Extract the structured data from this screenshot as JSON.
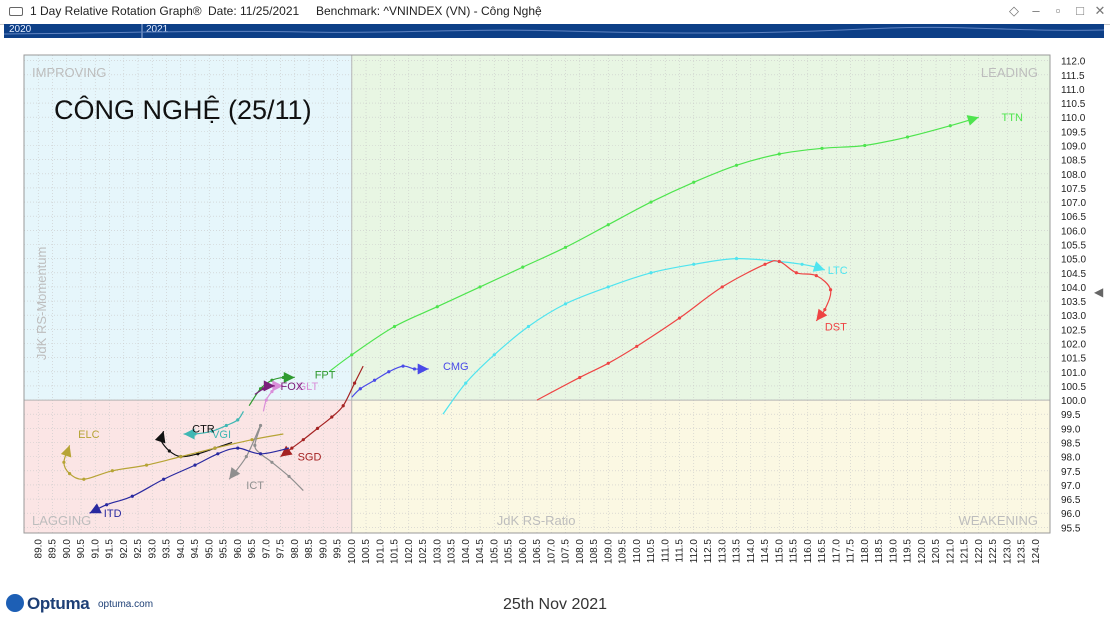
{
  "window": {
    "title": "1 Day Relative Rotation Graph®",
    "date_label": "Date: 11/25/2021",
    "benchmark_label": "Benchmark: ^VNINDEX (VN) - Công Nghệ"
  },
  "timeline": {
    "labels": [
      "2020",
      "2021"
    ]
  },
  "footer": {
    "brand": "Optuma",
    "brand_url": "optuma.com",
    "date_text": "25th Nov 2021"
  },
  "colors": {
    "improving": "#e6f6fb",
    "leading": "#e8f6e3",
    "weakening": "#fbf8e3",
    "lagging": "#fbe5e5",
    "grid": "#c9c9c9",
    "quadrant_label": "#bdbdbd",
    "header_blue": "#0d3f87"
  },
  "chart_data": {
    "type": "scatter",
    "title": "CÔNG NGHỆ (25/11)",
    "xlabel": "JdK RS-Ratio",
    "ylabel": "JdK RS-Momentum",
    "xlim": [
      88.5,
      124.5
    ],
    "ylim": [
      95.3,
      112.2
    ],
    "center": [
      100,
      100
    ],
    "grid": true,
    "quadrants": {
      "improving": "IMPROVING",
      "leading": "LEADING",
      "weakening": "WEAKENING",
      "lagging": "LAGGING"
    },
    "x_ticks": [
      "89.0",
      "89.5",
      "90.0",
      "90.5",
      "91.0",
      "91.5",
      "92.0",
      "92.5",
      "93.0",
      "93.5",
      "94.0",
      "94.5",
      "95.0",
      "95.5",
      "96.0",
      "96.5",
      "97.0",
      "97.5",
      "98.0",
      "98.5",
      "99.0",
      "99.5",
      "100.0",
      "100.5",
      "101.0",
      "101.5",
      "102.0",
      "102.5",
      "103.0",
      "103.5",
      "104.0",
      "104.5",
      "105.0",
      "105.5",
      "106.0",
      "106.5",
      "107.0",
      "107.5",
      "108.0",
      "108.5",
      "109.0",
      "109.5",
      "110.0",
      "110.5",
      "111.0",
      "111.5",
      "112.0",
      "112.5",
      "113.0",
      "113.5",
      "114.0",
      "114.5",
      "115.0",
      "115.5",
      "116.0",
      "116.5",
      "117.0",
      "117.5",
      "118.0",
      "118.5",
      "119.0",
      "119.5",
      "120.0",
      "120.5",
      "121.0",
      "121.5",
      "122.0",
      "122.5",
      "123.0",
      "123.5",
      "124.0"
    ],
    "y_ticks": [
      "95.5",
      "96.0",
      "96.5",
      "97.0",
      "97.5",
      "98.0",
      "98.5",
      "99.0",
      "99.5",
      "100.0",
      "100.5",
      "101.0",
      "101.5",
      "102.0",
      "102.5",
      "103.0",
      "103.5",
      "104.0",
      "104.5",
      "105.0",
      "105.5",
      "106.0",
      "106.5",
      "107.0",
      "107.5",
      "108.0",
      "108.5",
      "109.0",
      "109.5",
      "110.0",
      "110.5",
      "111.0",
      "111.5",
      "112.0"
    ],
    "series": [
      {
        "name": "TTN",
        "color": "#4ee44e",
        "label_at": [
          122.8,
          110.0
        ],
        "points": [
          [
            99.2,
            101.0
          ],
          [
            100.0,
            101.6
          ],
          [
            101.5,
            102.6
          ],
          [
            103.0,
            103.3
          ],
          [
            104.5,
            104.0
          ],
          [
            106.0,
            104.7
          ],
          [
            107.5,
            105.4
          ],
          [
            109.0,
            106.2
          ],
          [
            110.5,
            107.0
          ],
          [
            112.0,
            107.7
          ],
          [
            113.5,
            108.3
          ],
          [
            115.0,
            108.7
          ],
          [
            116.5,
            108.9
          ],
          [
            118.0,
            109.0
          ],
          [
            119.5,
            109.3
          ],
          [
            121.0,
            109.7
          ],
          [
            122.0,
            110.0
          ]
        ]
      },
      {
        "name": "LTC",
        "color": "#4fe4ef",
        "label_at": [
          116.7,
          104.6
        ],
        "points": [
          [
            103.2,
            99.5
          ],
          [
            104.0,
            100.6
          ],
          [
            105.0,
            101.6
          ],
          [
            106.2,
            102.6
          ],
          [
            107.5,
            103.4
          ],
          [
            109.0,
            104.0
          ],
          [
            110.5,
            104.5
          ],
          [
            112.0,
            104.8
          ],
          [
            113.5,
            105.0
          ],
          [
            115.0,
            104.9
          ],
          [
            115.8,
            104.8
          ],
          [
            116.3,
            104.7
          ],
          [
            116.6,
            104.6
          ]
        ]
      },
      {
        "name": "DST",
        "color": "#ee4444",
        "label_at": [
          116.6,
          102.6
        ],
        "points": [
          [
            106.5,
            100.0
          ],
          [
            108.0,
            100.8
          ],
          [
            109.0,
            101.3
          ],
          [
            110.0,
            101.9
          ],
          [
            111.5,
            102.9
          ],
          [
            113.0,
            104.0
          ],
          [
            114.5,
            104.8
          ],
          [
            115.0,
            104.9
          ],
          [
            115.6,
            104.5
          ],
          [
            116.3,
            104.4
          ],
          [
            116.8,
            103.9
          ],
          [
            116.6,
            103.2
          ],
          [
            116.3,
            102.8
          ]
        ]
      },
      {
        "name": "CMG",
        "color": "#4a4ae8",
        "label_at": [
          103.2,
          101.2
        ],
        "points": [
          [
            100.0,
            100.1
          ],
          [
            100.3,
            100.4
          ],
          [
            100.8,
            100.7
          ],
          [
            101.3,
            101.0
          ],
          [
            101.8,
            101.2
          ],
          [
            102.2,
            101.1
          ],
          [
            102.7,
            101.1
          ]
        ]
      },
      {
        "name": "FPT",
        "color": "#2f9a2f",
        "label_at": [
          98.7,
          100.9
        ],
        "points": [
          [
            96.4,
            99.8
          ],
          [
            96.8,
            100.4
          ],
          [
            97.2,
            100.7
          ],
          [
            97.6,
            100.8
          ],
          [
            98.0,
            100.8
          ]
        ]
      },
      {
        "name": "GLT",
        "color": "#d98ed9",
        "label_at": [
          98.1,
          100.5
        ],
        "points": [
          [
            96.9,
            99.6
          ],
          [
            97.0,
            100.0
          ],
          [
            97.2,
            100.3
          ],
          [
            97.4,
            100.5
          ],
          [
            97.6,
            100.5
          ]
        ]
      },
      {
        "name": "FOX",
        "color": "#7b1e7b",
        "label_at": [
          97.5,
          100.5
        ],
        "points": [
          [
            96.6,
            100.2
          ],
          [
            96.9,
            100.4
          ],
          [
            97.1,
            100.5
          ],
          [
            97.3,
            100.5
          ]
        ]
      },
      {
        "name": "VGI",
        "color": "#3fb7b3",
        "label_at": [
          95.1,
          98.8
        ],
        "points": [
          [
            96.2,
            99.6
          ],
          [
            96.0,
            99.3
          ],
          [
            95.6,
            99.1
          ],
          [
            95.1,
            98.9
          ],
          [
            94.5,
            98.8
          ],
          [
            94.1,
            98.8
          ]
        ]
      },
      {
        "name": "CTR",
        "color": "#111111",
        "label_at": [
          94.4,
          99.0
        ],
        "points": [
          [
            95.8,
            98.5
          ],
          [
            95.2,
            98.3
          ],
          [
            94.6,
            98.1
          ],
          [
            94.0,
            98.0
          ],
          [
            93.6,
            98.2
          ],
          [
            93.3,
            98.6
          ],
          [
            93.4,
            98.9
          ]
        ]
      },
      {
        "name": "ELC",
        "color": "#b7a435",
        "label_at": [
          90.4,
          98.8
        ],
        "points": [
          [
            97.6,
            98.8
          ],
          [
            96.5,
            98.6
          ],
          [
            95.2,
            98.3
          ],
          [
            94.0,
            98.0
          ],
          [
            92.8,
            97.7
          ],
          [
            91.6,
            97.5
          ],
          [
            90.6,
            97.2
          ],
          [
            90.1,
            97.4
          ],
          [
            89.9,
            97.8
          ],
          [
            90.1,
            98.4
          ]
        ]
      },
      {
        "name": "SGD",
        "color": "#a52222",
        "label_at": [
          98.1,
          98.0
        ],
        "points": [
          [
            100.4,
            101.2
          ],
          [
            100.1,
            100.6
          ],
          [
            99.7,
            99.8
          ],
          [
            99.3,
            99.4
          ],
          [
            98.8,
            99.0
          ],
          [
            98.3,
            98.6
          ],
          [
            97.9,
            98.3
          ],
          [
            97.5,
            98.0
          ]
        ]
      },
      {
        "name": "ICT",
        "color": "#8f8f8f",
        "label_at": [
          96.3,
          97.0
        ],
        "points": [
          [
            98.3,
            96.8
          ],
          [
            97.8,
            97.3
          ],
          [
            97.2,
            97.8
          ],
          [
            96.8,
            98.1
          ],
          [
            96.6,
            98.4
          ],
          [
            96.8,
            99.1
          ],
          [
            96.3,
            98.0
          ],
          [
            95.7,
            97.2
          ]
        ]
      },
      {
        "name": "ITD",
        "color": "#2929a0",
        "label_at": [
          91.3,
          96.0
        ],
        "points": [
          [
            97.8,
            98.3
          ],
          [
            96.8,
            98.1
          ],
          [
            96.0,
            98.3
          ],
          [
            95.3,
            98.1
          ],
          [
            94.5,
            97.7
          ],
          [
            93.4,
            97.2
          ],
          [
            92.3,
            96.6
          ],
          [
            91.4,
            96.3
          ],
          [
            90.8,
            96.0
          ]
        ]
      }
    ]
  }
}
